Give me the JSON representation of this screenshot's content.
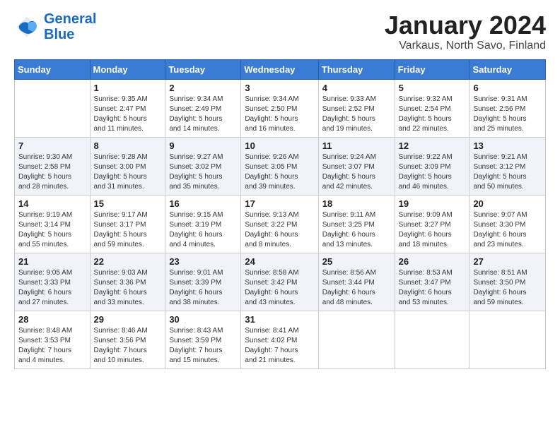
{
  "header": {
    "logo_line1": "General",
    "logo_line2": "Blue",
    "month": "January 2024",
    "location": "Varkaus, North Savo, Finland"
  },
  "weekdays": [
    "Sunday",
    "Monday",
    "Tuesday",
    "Wednesday",
    "Thursday",
    "Friday",
    "Saturday"
  ],
  "weeks": [
    [
      {
        "day": "",
        "info": ""
      },
      {
        "day": "1",
        "info": "Sunrise: 9:35 AM\nSunset: 2:47 PM\nDaylight: 5 hours\nand 11 minutes."
      },
      {
        "day": "2",
        "info": "Sunrise: 9:34 AM\nSunset: 2:49 PM\nDaylight: 5 hours\nand 14 minutes."
      },
      {
        "day": "3",
        "info": "Sunrise: 9:34 AM\nSunset: 2:50 PM\nDaylight: 5 hours\nand 16 minutes."
      },
      {
        "day": "4",
        "info": "Sunrise: 9:33 AM\nSunset: 2:52 PM\nDaylight: 5 hours\nand 19 minutes."
      },
      {
        "day": "5",
        "info": "Sunrise: 9:32 AM\nSunset: 2:54 PM\nDaylight: 5 hours\nand 22 minutes."
      },
      {
        "day": "6",
        "info": "Sunrise: 9:31 AM\nSunset: 2:56 PM\nDaylight: 5 hours\nand 25 minutes."
      }
    ],
    [
      {
        "day": "7",
        "info": "Sunrise: 9:30 AM\nSunset: 2:58 PM\nDaylight: 5 hours\nand 28 minutes."
      },
      {
        "day": "8",
        "info": "Sunrise: 9:28 AM\nSunset: 3:00 PM\nDaylight: 5 hours\nand 31 minutes."
      },
      {
        "day": "9",
        "info": "Sunrise: 9:27 AM\nSunset: 3:02 PM\nDaylight: 5 hours\nand 35 minutes."
      },
      {
        "day": "10",
        "info": "Sunrise: 9:26 AM\nSunset: 3:05 PM\nDaylight: 5 hours\nand 39 minutes."
      },
      {
        "day": "11",
        "info": "Sunrise: 9:24 AM\nSunset: 3:07 PM\nDaylight: 5 hours\nand 42 minutes."
      },
      {
        "day": "12",
        "info": "Sunrise: 9:22 AM\nSunset: 3:09 PM\nDaylight: 5 hours\nand 46 minutes."
      },
      {
        "day": "13",
        "info": "Sunrise: 9:21 AM\nSunset: 3:12 PM\nDaylight: 5 hours\nand 50 minutes."
      }
    ],
    [
      {
        "day": "14",
        "info": "Sunrise: 9:19 AM\nSunset: 3:14 PM\nDaylight: 5 hours\nand 55 minutes."
      },
      {
        "day": "15",
        "info": "Sunrise: 9:17 AM\nSunset: 3:17 PM\nDaylight: 5 hours\nand 59 minutes."
      },
      {
        "day": "16",
        "info": "Sunrise: 9:15 AM\nSunset: 3:19 PM\nDaylight: 6 hours\nand 4 minutes."
      },
      {
        "day": "17",
        "info": "Sunrise: 9:13 AM\nSunset: 3:22 PM\nDaylight: 6 hours\nand 8 minutes."
      },
      {
        "day": "18",
        "info": "Sunrise: 9:11 AM\nSunset: 3:25 PM\nDaylight: 6 hours\nand 13 minutes."
      },
      {
        "day": "19",
        "info": "Sunrise: 9:09 AM\nSunset: 3:27 PM\nDaylight: 6 hours\nand 18 minutes."
      },
      {
        "day": "20",
        "info": "Sunrise: 9:07 AM\nSunset: 3:30 PM\nDaylight: 6 hours\nand 23 minutes."
      }
    ],
    [
      {
        "day": "21",
        "info": "Sunrise: 9:05 AM\nSunset: 3:33 PM\nDaylight: 6 hours\nand 27 minutes."
      },
      {
        "day": "22",
        "info": "Sunrise: 9:03 AM\nSunset: 3:36 PM\nDaylight: 6 hours\nand 33 minutes."
      },
      {
        "day": "23",
        "info": "Sunrise: 9:01 AM\nSunset: 3:39 PM\nDaylight: 6 hours\nand 38 minutes."
      },
      {
        "day": "24",
        "info": "Sunrise: 8:58 AM\nSunset: 3:42 PM\nDaylight: 6 hours\nand 43 minutes."
      },
      {
        "day": "25",
        "info": "Sunrise: 8:56 AM\nSunset: 3:44 PM\nDaylight: 6 hours\nand 48 minutes."
      },
      {
        "day": "26",
        "info": "Sunrise: 8:53 AM\nSunset: 3:47 PM\nDaylight: 6 hours\nand 53 minutes."
      },
      {
        "day": "27",
        "info": "Sunrise: 8:51 AM\nSunset: 3:50 PM\nDaylight: 6 hours\nand 59 minutes."
      }
    ],
    [
      {
        "day": "28",
        "info": "Sunrise: 8:48 AM\nSunset: 3:53 PM\nDaylight: 7 hours\nand 4 minutes."
      },
      {
        "day": "29",
        "info": "Sunrise: 8:46 AM\nSunset: 3:56 PM\nDaylight: 7 hours\nand 10 minutes."
      },
      {
        "day": "30",
        "info": "Sunrise: 8:43 AM\nSunset: 3:59 PM\nDaylight: 7 hours\nand 15 minutes."
      },
      {
        "day": "31",
        "info": "Sunrise: 8:41 AM\nSunset: 4:02 PM\nDaylight: 7 hours\nand 21 minutes."
      },
      {
        "day": "",
        "info": ""
      },
      {
        "day": "",
        "info": ""
      },
      {
        "day": "",
        "info": ""
      }
    ]
  ]
}
